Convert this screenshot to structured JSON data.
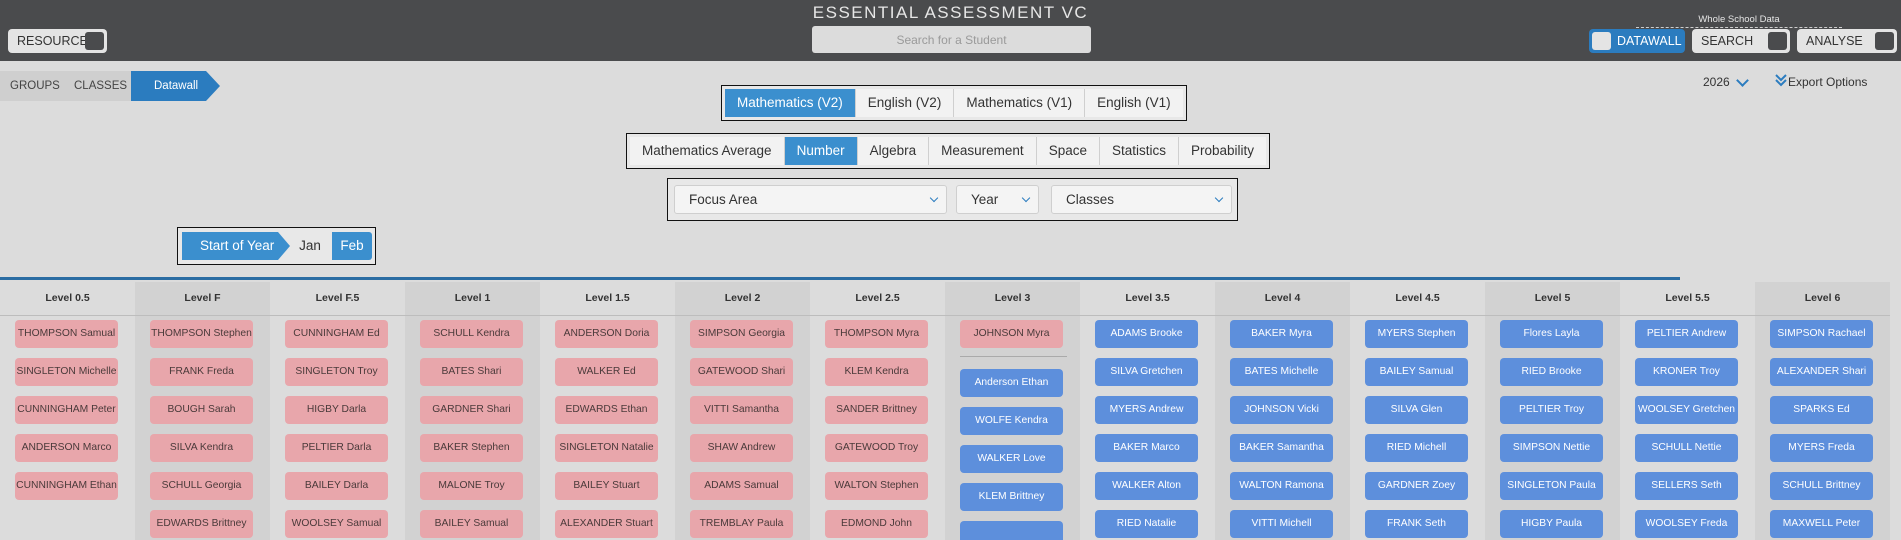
{
  "app": {
    "title": "ESSENTIAL ASSESSMENT VC",
    "search_placeholder": "Search for a Student"
  },
  "topnav": {
    "resources": "RESOURCES",
    "whole_school_label": "Whole School Data",
    "datawall": "DATAWALL",
    "search": "SEARCH",
    "analyse": "ANALYSE"
  },
  "breadcrumb": [
    "GROUPS",
    "CLASSES",
    "Datawall"
  ],
  "year": "2026",
  "export_label": "Export Options",
  "subjects": [
    {
      "label": "Mathematics (V2)",
      "active": true
    },
    {
      "label": "English (V2)",
      "active": false
    },
    {
      "label": "Mathematics (V1)",
      "active": false
    },
    {
      "label": "English (V1)",
      "active": false
    }
  ],
  "strands": [
    {
      "label": "Mathematics Average",
      "active": false
    },
    {
      "label": "Number",
      "active": true
    },
    {
      "label": "Algebra",
      "active": false
    },
    {
      "label": "Measurement",
      "active": false
    },
    {
      "label": "Space",
      "active": false
    },
    {
      "label": "Statistics",
      "active": false
    },
    {
      "label": "Probability",
      "active": false
    }
  ],
  "filters": {
    "focus_area": "Focus Area",
    "year": "Year",
    "classes": "Classes"
  },
  "periods": {
    "start": "Start of Year",
    "jan": "Jan",
    "feb": "Feb"
  },
  "colors": {
    "accent": "#3b8fce",
    "pink_card": "#e8a6ab",
    "blue_card": "#5d8fdc",
    "topbar": "#4a4b4d"
  },
  "levels": [
    {
      "name": "Level 0.5",
      "color": "pink",
      "students": [
        "THOMPSON Samual",
        "SINGLETON Michelle",
        "CUNNINGHAM Peter",
        "ANDERSON Marco",
        "CUNNINGHAM Ethan"
      ]
    },
    {
      "name": "Level F",
      "color": "pink",
      "students": [
        "THOMPSON Stephen",
        "FRANK Freda",
        "BOUGH Sarah",
        "SILVA Kendra",
        "SCHULL Georgia",
        "EDWARDS Brittney"
      ]
    },
    {
      "name": "Level F.5",
      "color": "pink",
      "students": [
        "CUNNINGHAM Ed",
        "SINGLETON Troy",
        "HIGBY Darla",
        "PELTIER Darla",
        "BAILEY Darla",
        "WOOLSEY Samual"
      ]
    },
    {
      "name": "Level 1",
      "color": "pink",
      "students": [
        "SCHULL Kendra",
        "BATES Shari",
        "GARDNER Shari",
        "BAKER Stephen",
        "MALONE Troy",
        "BAILEY Samual"
      ]
    },
    {
      "name": "Level 1.5",
      "color": "pink",
      "students": [
        "ANDERSON Doria",
        "WALKER Ed",
        "EDWARDS Ethan",
        "SINGLETON Natalie",
        "BAILEY Stuart",
        "ALEXANDER Stuart"
      ]
    },
    {
      "name": "Level 2",
      "color": "pink",
      "students": [
        "SIMPSON Georgia",
        "GATEWOOD Shari",
        "VITTI Samantha",
        "SHAW Andrew",
        "ADAMS Samual",
        "TREMBLAY Paula"
      ]
    },
    {
      "name": "Level 2.5",
      "color": "pink",
      "students": [
        "THOMPSON Myra",
        "KLEM Kendra",
        "SANDER Brittney",
        "GATEWOOD Troy",
        "WALTON Stephen",
        "EDMOND John"
      ]
    },
    {
      "name": "Level 3",
      "color": "split",
      "above": [
        "JOHNSON Myra"
      ],
      "students": [
        "Anderson Ethan",
        "WOLFE Kendra",
        "WALKER Love",
        "KLEM Brittney",
        ""
      ]
    },
    {
      "name": "Level 3.5",
      "color": "blue",
      "students": [
        "ADAMS Brooke",
        "SILVA Gretchen",
        "MYERS Andrew",
        "BAKER Marco",
        "WALKER Alton",
        "RIED Natalie"
      ]
    },
    {
      "name": "Level 4",
      "color": "blue",
      "students": [
        "BAKER Myra",
        "BATES Michelle",
        "JOHNSON Vicki",
        "BAKER Samantha",
        "WALTON Ramona",
        "VITTI Michell"
      ]
    },
    {
      "name": "Level 4.5",
      "color": "blue",
      "students": [
        "MYERS Stephen",
        "BAILEY Samual",
        "SILVA Glen",
        "RIED Michell",
        "GARDNER Zoey",
        "FRANK Seth"
      ]
    },
    {
      "name": "Level 5",
      "color": "blue",
      "students": [
        "Flores Layla",
        "RIED Brooke",
        "PELTIER Troy",
        "SIMPSON Nettie",
        "SINGLETON Paula",
        "HIGBY Paula"
      ]
    },
    {
      "name": "Level 5.5",
      "color": "blue",
      "students": [
        "PELTIER Andrew",
        "KRONER Troy",
        "WOOLSEY Gretchen",
        "SCHULL Nettie",
        "SELLERS Seth",
        "WOOLSEY Freda"
      ]
    },
    {
      "name": "Level 6",
      "color": "blue",
      "students": [
        "SIMPSON Rachael",
        "ALEXANDER Shari",
        "SPARKS Ed",
        "MYERS Freda",
        "SCHULL Brittney",
        "MAXWELL Peter"
      ]
    }
  ]
}
